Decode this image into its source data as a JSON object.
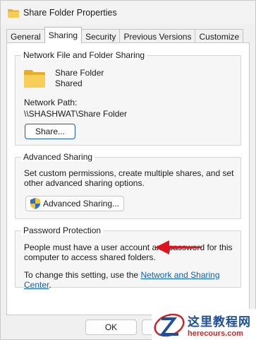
{
  "window": {
    "title": "Share Folder Properties"
  },
  "tabs": [
    {
      "label": "General"
    },
    {
      "label": "Sharing"
    },
    {
      "label": "Security"
    },
    {
      "label": "Previous Versions"
    },
    {
      "label": "Customize"
    }
  ],
  "network_sharing": {
    "legend": "Network File and Folder Sharing",
    "folder_name": "Share Folder",
    "status": "Shared",
    "network_path_label": "Network Path:",
    "network_path": "\\\\SHASHWAT\\Share Folder",
    "share_button": "Share..."
  },
  "advanced_sharing": {
    "legend": "Advanced Sharing",
    "description": "Set custom permissions, create multiple shares, and set other advanced sharing options.",
    "button": "Advanced Sharing..."
  },
  "password_protection": {
    "legend": "Password Protection",
    "description": "People must have a user account and password for this computer to access shared folders.",
    "change_prefix": "To change this setting, use the ",
    "link": "Network and Sharing Center",
    "change_suffix": "."
  },
  "footer": {
    "ok": "OK",
    "cancel": "Cancel"
  },
  "watermark": {
    "cn": "这里教程网",
    "url": "herecours.com"
  },
  "colors": {
    "accent": "#1c5fb5",
    "link": "#0b61b8",
    "arrow": "#e0141e",
    "folder": "#f6c643"
  }
}
